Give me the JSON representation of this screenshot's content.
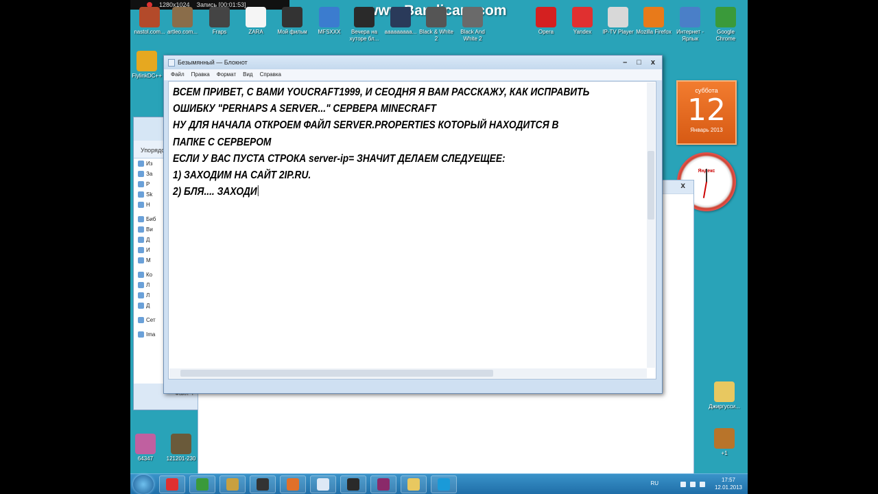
{
  "recording": {
    "resolution": "1280x1024",
    "status": "Запись [00:01:53]"
  },
  "watermark": "www.Bandicam.com",
  "desktop_icons_top": [
    {
      "label": "nastol.com...",
      "color": "#b34a2a"
    },
    {
      "label": "artleo.com...",
      "color": "#8a6d4a"
    },
    {
      "label": "Fraps",
      "color": "#444444"
    },
    {
      "label": "ZARA",
      "color": "#f5f5f5"
    },
    {
      "label": "Мой фильм",
      "color": "#333333"
    },
    {
      "label": "MFSXXX",
      "color": "#3b7ccf"
    },
    {
      "label": "Вечера на хуторе бл...",
      "color": "#2a2a2a"
    },
    {
      "label": "ааааааааа...",
      "color": "#2a3a5a"
    },
    {
      "label": "Black & White 2",
      "color": "#555555"
    },
    {
      "label": "Black And White 2",
      "color": "#6a6a6a"
    },
    {
      "label": "Opera",
      "color": "#d42020"
    },
    {
      "label": "Yandex",
      "color": "#e03030"
    },
    {
      "label": "IP-TV Player",
      "color": "#d8d8d8"
    },
    {
      "label": "Mozilla Firefox",
      "color": "#e87a1a"
    },
    {
      "label": "Интернет - Ярлык",
      "color": "#4a7fc8"
    },
    {
      "label": "Google Chrome",
      "color": "#3a9a3a"
    }
  ],
  "desktop_icons_left": [
    {
      "label": "FlylinkDC++",
      "color": "#e6a820"
    },
    {
      "label": "64347",
      "color": "#c060a0"
    },
    {
      "label": "121201-230",
      "color": "#6a5a3a"
    }
  ],
  "desktop_icons_right": [
    {
      "label": "Джиргусси...",
      "color": "#e8c860"
    },
    {
      "label": "+1",
      "color": "#b8742a"
    }
  ],
  "calendar": {
    "weekday": "суббота",
    "day": "12",
    "month_year": "Январь 2013"
  },
  "clock": {
    "brand": "Яндекс"
  },
  "explorer": {
    "toolbar_label": "Упорядо",
    "rows": [
      "Из",
      "За",
      "Р",
      "Sk",
      "Н",
      "Биб",
      "Ви",
      "Д",
      "И",
      "М",
      "Ко",
      "Л",
      "Л",
      "Д",
      "Сет",
      "Ima"
    ],
    "status": "Файл \"Р"
  },
  "notepad": {
    "title": "Безымянный — Блокнот",
    "menu": [
      "Файл",
      "Правка",
      "Формат",
      "Вид",
      "Справка"
    ],
    "controls": {
      "minimize": "–",
      "maximize": "□",
      "close": "x"
    },
    "lines": [
      "ВСЕМ ПРИВЕТ, С ВАМИ YOUCRAFT1999, И СЕОДНЯ Я ВАМ РАССКАЖУ, КАК ИСПРАВИТЬ",
      "ОШИБКУ \"PERHAPS A SERVER...\"  СЕРВЕРА MINECRAFT",
      "НУ ДЛЯ НАЧАЛА ОТКРОЕМ ФАЙЛ SERVER.PROPERTIES КОТОРЫЙ НАХОДИТСЯ В",
      "ПАПКЕ С СЕРВЕРОМ",
      "ЕСЛИ У ВАС ПУСТА СТРОКА server-ip= ЗНАЧИТ ДЕЛАЕМ СЛЕДУЕЩЕЕ:",
      "1) ЗАХОДИМ НА САЙТ 2IP.RU.",
      "2) БЛЯ.... ЗАХОДИ"
    ]
  },
  "bg_window_close": "x",
  "taskbar": {
    "items": [
      {
        "name": "yandex-browser",
        "color": "#e03030"
      },
      {
        "name": "chrome",
        "color": "#3a9a3a"
      },
      {
        "name": "paint",
        "color": "#c8a040"
      },
      {
        "name": "microphone",
        "color": "#333333"
      },
      {
        "name": "media-player",
        "color": "#e0702a"
      },
      {
        "name": "notepad",
        "color": "#dde8f5"
      },
      {
        "name": "game",
        "color": "#2a2a2a"
      },
      {
        "name": "winrar",
        "color": "#8a2a6a"
      },
      {
        "name": "explorer",
        "color": "#e8c860"
      },
      {
        "name": "skype",
        "color": "#1a9ad8"
      }
    ],
    "lang": "RU",
    "time": "17:57",
    "date": "12.01.2013"
  }
}
